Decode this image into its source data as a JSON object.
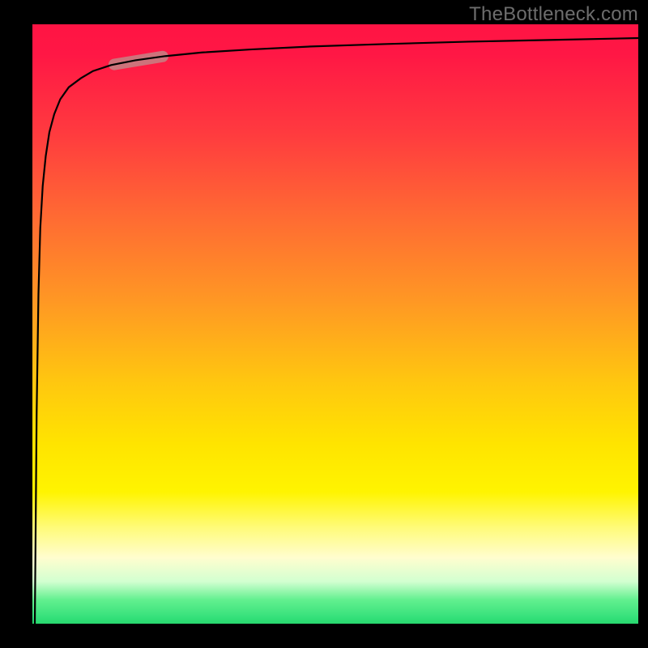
{
  "watermark": "TheBottleneck.com",
  "colors": {
    "gradient_top": "#ff1444",
    "gradient_mid": "#ffe400",
    "gradient_bottom": "#28d86e",
    "curve": "#000000",
    "emphasis": "#c78083",
    "watermark_text": "#6d6d6d"
  },
  "chart_data": {
    "type": "line",
    "title": "",
    "xlabel": "",
    "ylabel": "",
    "xlim": [
      0,
      100
    ],
    "ylim": [
      0,
      100
    ],
    "grid": false,
    "legend": false,
    "background": "vertical-gradient red→yellow→green, green at y≈0",
    "series": [
      {
        "name": "curve",
        "comment": "Steep logarithmic-like rise from bottom-left tip, flattening toward top. Values estimated from pixel positions.",
        "x": [
          0.4,
          0.7,
          1.0,
          1.3,
          1.7,
          2.2,
          2.8,
          3.6,
          4.6,
          6.0,
          8.0,
          10,
          13,
          17,
          22,
          28,
          36,
          46,
          58,
          72,
          86,
          100
        ],
        "y": [
          0,
          35,
          55,
          66,
          73,
          78,
          82,
          85,
          87.5,
          89.5,
          91,
          92.2,
          93.2,
          94,
          94.7,
          95.3,
          95.8,
          96.3,
          96.7,
          97.1,
          97.4,
          97.7
        ]
      }
    ],
    "annotations": [
      {
        "name": "emphasis-segment",
        "comment": "Thick muted-pink lozenge highlighting a short segment of the curve near the upper-left knee.",
        "x_range": [
          13.5,
          21.5
        ],
        "y_range": [
          93.0,
          94.6
        ]
      }
    ]
  }
}
